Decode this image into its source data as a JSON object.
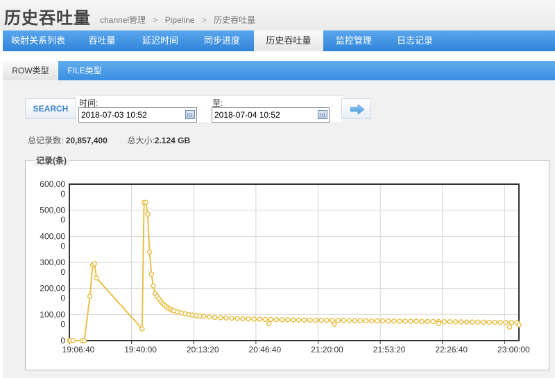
{
  "header": {
    "title": "历史吞吐量",
    "breadcrumb": [
      "channel管理",
      "Pipeline",
      "历史吞吐量"
    ],
    "separator": ">"
  },
  "nav": {
    "items": [
      {
        "label": "映射关系列表",
        "active": false
      },
      {
        "label": "吞吐量",
        "active": false
      },
      {
        "label": "延迟时间",
        "active": false
      },
      {
        "label": "同步进度",
        "active": false
      },
      {
        "label": "历史吞吐量",
        "active": true
      },
      {
        "label": "监控管理",
        "active": false
      },
      {
        "label": "日志记录",
        "active": false
      }
    ]
  },
  "subnav": {
    "items": [
      {
        "label": "ROW类型",
        "active": true
      },
      {
        "label": "FILE类型",
        "active": false
      }
    ]
  },
  "search": {
    "button_label": "SEARCH",
    "from_label": "时间:",
    "from_value": "2018-07-03 10:52",
    "to_label": "至:",
    "to_value": "2018-07-04 10:52",
    "go_icon": "arrow-right-icon"
  },
  "stats": {
    "total_records_label": "总记录数:",
    "total_records_value": "20,857,400",
    "total_size_label": "总大小:",
    "total_size_value": "2.124 GB"
  },
  "chart_panel": {
    "legend": "记录(条)"
  },
  "colors": {
    "accent": "#3a8de0",
    "series": "#e8c04a"
  },
  "chart_data": {
    "type": "line",
    "title": "",
    "xlabel": "",
    "ylabel": "记录(条)",
    "ylim": [
      0,
      600000
    ],
    "y_ticks": [
      {
        "value": 0,
        "label": "0"
      },
      {
        "value": 100000,
        "label": "100,00\n0"
      },
      {
        "value": 200000,
        "label": "200,00\n0"
      },
      {
        "value": 300000,
        "label": "300,00\n0"
      },
      {
        "value": 400000,
        "label": "400,00\n0"
      },
      {
        "value": 500000,
        "label": "500,00\n0"
      },
      {
        "value": 600000,
        "label": "600,00\n0"
      }
    ],
    "x_unit": "minutes since 19:06:40",
    "xlim": [
      0,
      241
    ],
    "x_ticks": [
      {
        "value": 0,
        "label": "19:06:40"
      },
      {
        "value": 33.33,
        "label": "19:40:00"
      },
      {
        "value": 66.67,
        "label": "20:13:20"
      },
      {
        "value": 100,
        "label": "20:46:40"
      },
      {
        "value": 133.33,
        "label": "21:20:00"
      },
      {
        "value": 166.67,
        "label": "21:53:20"
      },
      {
        "value": 200,
        "label": "22:26:40"
      },
      {
        "value": 233.33,
        "label": "23:00:00"
      }
    ],
    "grid": true,
    "series": [
      {
        "name": "",
        "points": [
          [
            0,
            0
          ],
          [
            0.5,
            0
          ],
          [
            2,
            0
          ],
          [
            7,
            0
          ],
          [
            8,
            0
          ],
          [
            11,
            170000
          ],
          [
            12.5,
            290000
          ],
          [
            13.5,
            295000
          ],
          [
            14.5,
            240000
          ],
          [
            39,
            45000
          ],
          [
            40,
            530000
          ],
          [
            41,
            530000
          ],
          [
            42,
            485000
          ],
          [
            43,
            340000
          ],
          [
            44,
            255000
          ],
          [
            45,
            210000
          ],
          [
            46,
            180000
          ],
          [
            47,
            170000
          ],
          [
            48,
            160000
          ],
          [
            49,
            150000
          ],
          [
            50,
            142000
          ],
          [
            51,
            136000
          ],
          [
            52,
            130000
          ],
          [
            53,
            125000
          ],
          [
            54,
            121000
          ],
          [
            55,
            117000
          ],
          [
            56,
            114000
          ],
          [
            58,
            110000
          ],
          [
            60,
            106000
          ],
          [
            62,
            103000
          ],
          [
            64,
            100000
          ],
          [
            66,
            98000
          ],
          [
            68,
            96000
          ],
          [
            70,
            94000
          ],
          [
            72,
            93000
          ],
          [
            75,
            91000
          ],
          [
            78,
            89000
          ],
          [
            81,
            88000
          ],
          [
            84,
            87000
          ],
          [
            87,
            86000
          ],
          [
            90,
            85000
          ],
          [
            93,
            84000
          ],
          [
            96,
            83000
          ],
          [
            99,
            82500
          ],
          [
            102,
            82000
          ],
          [
            105,
            81500
          ],
          [
            108,
            81000
          ],
          [
            111,
            80500
          ],
          [
            114,
            80000
          ],
          [
            117,
            80000
          ],
          [
            120,
            79500
          ],
          [
            123,
            79000
          ],
          [
            126,
            79000
          ],
          [
            129,
            78500
          ],
          [
            132,
            78500
          ],
          [
            135,
            78000
          ],
          [
            138,
            78000
          ],
          [
            141,
            77500
          ],
          [
            144,
            77500
          ],
          [
            147,
            77000
          ],
          [
            150,
            77000
          ],
          [
            153,
            76500
          ],
          [
            156,
            76500
          ],
          [
            159,
            76000
          ],
          [
            162,
            76000
          ],
          [
            165,
            75500
          ],
          [
            168,
            75500
          ],
          [
            171,
            75000
          ],
          [
            174,
            75000
          ],
          [
            177,
            74500
          ],
          [
            180,
            74500
          ],
          [
            183,
            74000
          ],
          [
            186,
            74000
          ],
          [
            189,
            73500
          ],
          [
            192,
            73500
          ],
          [
            195,
            73000
          ],
          [
            198,
            73000
          ],
          [
            201,
            72500
          ],
          [
            204,
            72500
          ],
          [
            207,
            72000
          ],
          [
            210,
            72000
          ],
          [
            213,
            71500
          ],
          [
            216,
            71500
          ],
          [
            219,
            71000
          ],
          [
            222,
            71000
          ],
          [
            225,
            70500
          ],
          [
            228,
            70500
          ],
          [
            231,
            70000
          ],
          [
            234,
            70000
          ],
          [
            237,
            69500
          ],
          [
            240,
            69000
          ],
          [
            241,
            60000
          ]
        ],
        "outliers": [
          [
            107,
            65000
          ],
          [
            142,
            63000
          ],
          [
            198,
            66000
          ],
          [
            236,
            52000
          ]
        ]
      }
    ]
  }
}
